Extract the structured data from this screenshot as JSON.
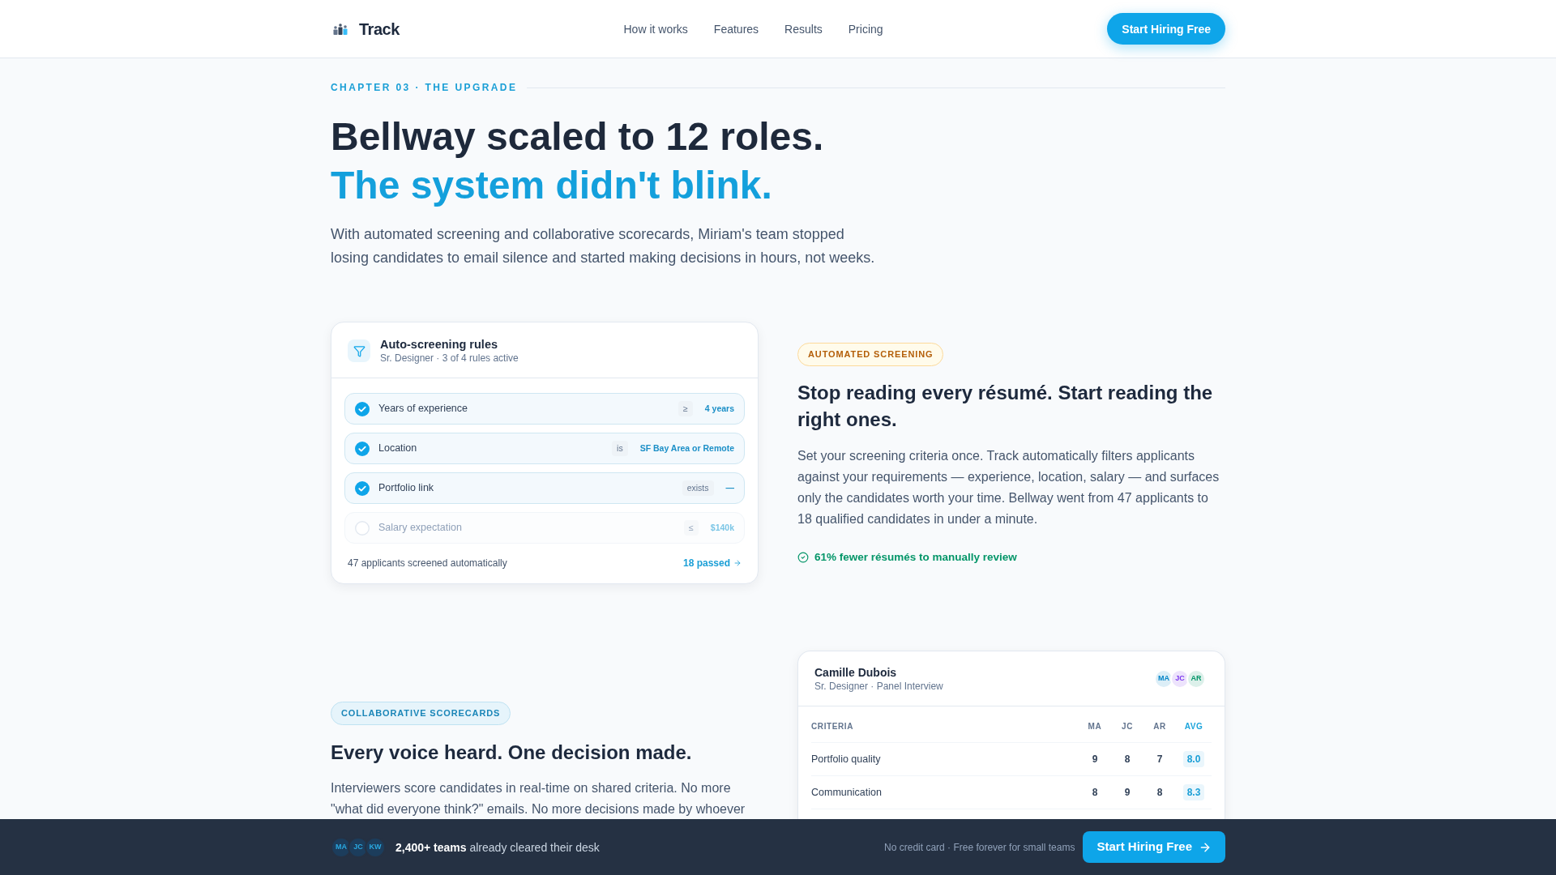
{
  "nav": {
    "logo": "Track",
    "links": [
      "How it works",
      "Features",
      "Results",
      "Pricing"
    ],
    "cta": "Start Hiring Free"
  },
  "hero": {
    "eyebrow": "CHAPTER 03 · THE UPGRADE",
    "title": "Bellway scaled to 12 roles.",
    "title_accent": "The system didn't blink.",
    "lead": "With automated screening and collaborative scorecards, Miriam's team stopped losing candidates to email silence and started making decisions in hours, not weeks."
  },
  "screening_card": {
    "title": "Auto-screening rules",
    "subtitle": "Sr. Designer · 3 of 4 rules active",
    "rules": [
      {
        "label": "Years of experience",
        "operator": "≥",
        "value": "4 years",
        "checked": true
      },
      {
        "label": "Location",
        "operator": "is",
        "value": "SF Bay Area or Remote",
        "checked": true
      },
      {
        "label": "Portfolio link",
        "operator": "exists",
        "value": "—",
        "checked": true
      },
      {
        "label": "Salary expectation",
        "operator": "≤",
        "value": "$140k",
        "checked": false
      }
    ],
    "summary": "47 applicants screened automatically",
    "link": "18 passed"
  },
  "screening_feature": {
    "badge": "AUTOMATED SCREENING",
    "heading": "Stop reading every résumé. Start reading the right ones.",
    "body": "Set your screening criteria once. Track automatically filters applicants against your requirements — experience, location, salary — and surfaces only the candidates worth your time. Bellway went from 47 applicants to 18 qualified candidates in under a minute.",
    "stat": "61% fewer résumés to manually review"
  },
  "scorecard_feature": {
    "badge": "COLLABORATIVE SCORECARDS",
    "heading": "Every voice heard. One decision made.",
    "body": "Interviewers score candidates in real-time on shared criteria. No more \"what did everyone think?\" emails. No more decisions made by whoever"
  },
  "scorecard_card": {
    "candidate": "Camille Dubois",
    "subtitle": "Sr. Designer · Panel Interview",
    "panel": [
      {
        "initials": "MA",
        "color": "#0284c7"
      },
      {
        "initials": "JC",
        "color": "#7c3aed"
      },
      {
        "initials": "AR",
        "color": "#059669"
      }
    ],
    "columns": [
      "CRITERIA",
      "MA",
      "JC",
      "AR",
      "AVG"
    ],
    "rows": [
      {
        "criterion": "Portfolio quality",
        "scores": [
          "9",
          "8",
          "7"
        ],
        "average": "8.0"
      },
      {
        "criterion": "Communication",
        "scores": [
          "8",
          "9",
          "8"
        ],
        "average": "8.3"
      }
    ]
  },
  "bottom_bar": {
    "avatars": [
      "MA",
      "JC",
      "KW"
    ],
    "headline": "**2,400+ teams** already cleared their desk",
    "note": "No credit card · Free forever for small teams",
    "cta": "Start Hiring Free"
  }
}
